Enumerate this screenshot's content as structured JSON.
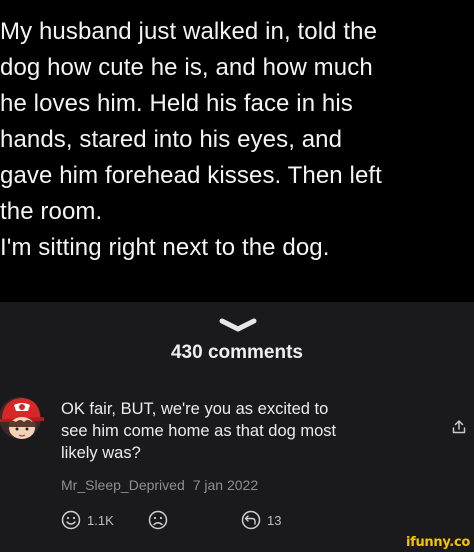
{
  "post": {
    "text": "My husband just walked in, told the\ndog how cute he is, and how much\nhe loves him. Held his face in his\nhands, stared into his eyes, and\ngave him forehead kisses. Then left\nthe room.\nI'm sitting right next to the dog."
  },
  "comments": {
    "title": "430 comments",
    "items": [
      {
        "text": "OK fair, BUT, we're you as excited to\nsee him come home as that dog most\nlikely was?",
        "author": "Mr_Sleep_Deprived",
        "date": "7 jan 2022",
        "likes": "1.1K",
        "replies": "13"
      }
    ]
  },
  "icons": {
    "handle": "chevron-down-icon",
    "like": "smile-icon",
    "dislike": "frown-icon",
    "reply": "reply-icon",
    "share": "share-icon"
  },
  "watermark": "ifunny.co"
}
